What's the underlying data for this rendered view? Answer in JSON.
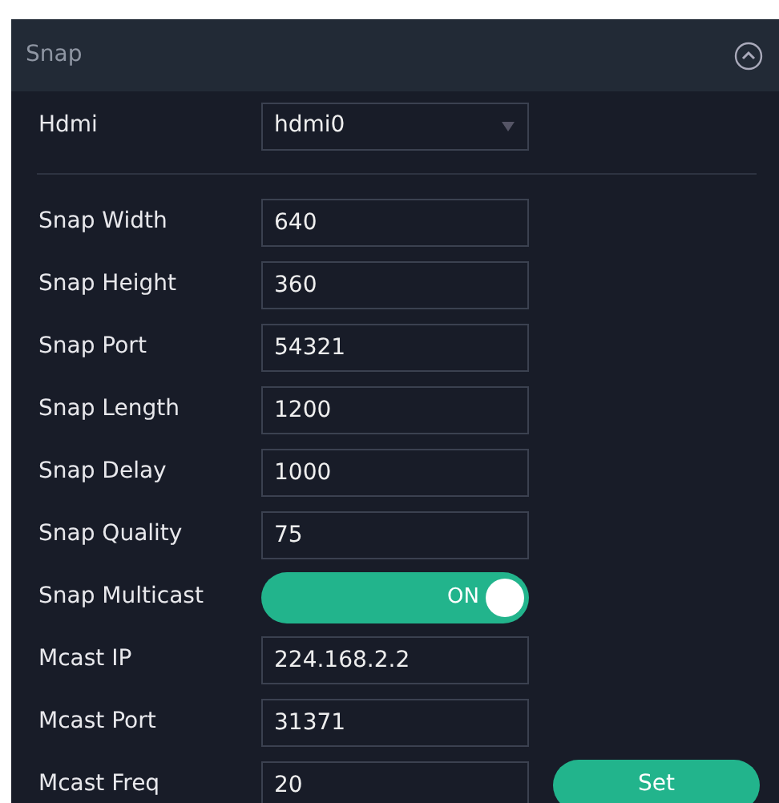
{
  "panel": {
    "title": "Snap",
    "expanded": true
  },
  "hdmi": {
    "label": "Hdmi",
    "value": "hdmi0"
  },
  "fields": [
    {
      "kind": "text",
      "label": "Snap Width",
      "value": "640"
    },
    {
      "kind": "text",
      "label": "Snap Height",
      "value": "360"
    },
    {
      "kind": "text",
      "label": "Snap Port",
      "value": "54321"
    },
    {
      "kind": "text",
      "label": "Snap Length",
      "value": "1200"
    },
    {
      "kind": "text",
      "label": "Snap Delay",
      "value": "1000"
    },
    {
      "kind": "text",
      "label": "Snap Quality",
      "value": "75"
    },
    {
      "kind": "toggle",
      "label": "Snap Multicast",
      "on": true,
      "text": "ON"
    },
    {
      "kind": "text",
      "label": "Mcast IP",
      "value": "224.168.2.2"
    },
    {
      "kind": "text",
      "label": "Mcast Port",
      "value": "31371"
    },
    {
      "kind": "text",
      "label": "Mcast Freq",
      "value": "20"
    }
  ],
  "button": "Set"
}
